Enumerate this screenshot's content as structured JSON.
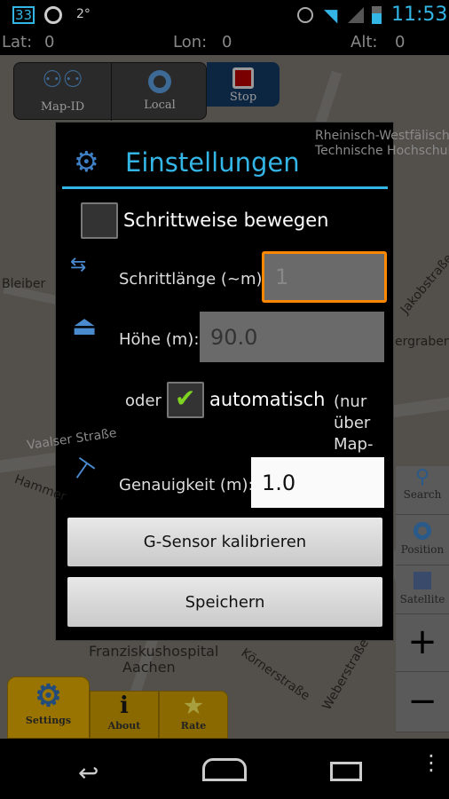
{
  "status_bar": {
    "notification_badge": "33",
    "temperature": "2°",
    "time": "11:53",
    "icons": [
      "gps-icon",
      "alarm-icon",
      "wifi-icon",
      "signal-icon",
      "battery-charging-icon"
    ]
  },
  "coords": {
    "lat_label": "Lat:",
    "lat_value": "0",
    "lon_label": "Lon:",
    "lon_value": "0",
    "alt_label": "Alt:",
    "alt_value": "0"
  },
  "toolbar": {
    "map_id": "Map-ID",
    "local": "Local",
    "stop": "Stop"
  },
  "map_labels": [
    "Rheinisch-Westfälische",
    "Technische Hochschule",
    "Bleiber",
    "Jakobstraße",
    "ergraben",
    "Vaalser Straße",
    "Hammer",
    "Franziskushospital",
    "Aachen",
    "Körnerstraße",
    "Weberstraße"
  ],
  "dialog": {
    "title": "Einstellungen",
    "step_checkbox_label": "Schrittweise bewegen",
    "step_checked": false,
    "step_length_label": "Schrittlänge (~m):",
    "step_length_value": "1",
    "height_label": "Höhe (m):",
    "height_value": "90.0",
    "or_label": "oder",
    "auto_label": "automatisch",
    "auto_checked": true,
    "auto_note": "(nur über Map-",
    "accuracy_label": "Genauigkeit (m):",
    "accuracy_value": "1.0",
    "calibrate_button": "G-Sensor kalibrieren",
    "save_button": "Speichern",
    "accent": "#33b5e5",
    "focus_color": "#ff8800"
  },
  "side_panel": {
    "search": "Search",
    "position": "Position",
    "satellite": "Satellite",
    "zoom_in": "+",
    "zoom_out": "−"
  },
  "bottom_tabs": {
    "settings": "Settings",
    "about": "About",
    "rate": "Rate"
  }
}
